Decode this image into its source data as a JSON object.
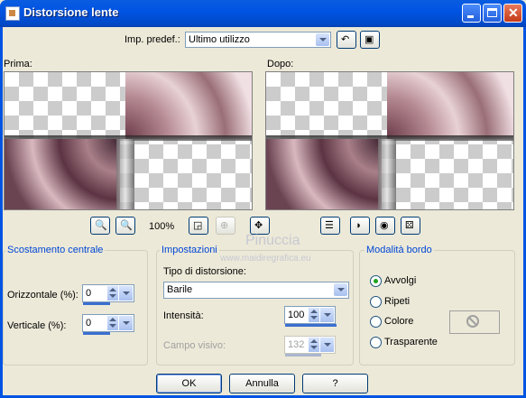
{
  "window": {
    "title": "Distorsione lente"
  },
  "preset": {
    "label": "Imp. predef.:",
    "value": "Ultimo utilizzo"
  },
  "previews": {
    "before_label": "Prima:",
    "after_label": "Dopo:",
    "zoom": "100%"
  },
  "watermark": {
    "name": "Pinuccia",
    "url": "www.maidiregrafica.eu"
  },
  "center_offset": {
    "title": "Scostamento centrale",
    "horizontal_label": "Orizzontale (%):",
    "horizontal_value": "0",
    "vertical_label": "Verticale (%):",
    "vertical_value": "0"
  },
  "settings": {
    "title": "Impostazioni",
    "distortion_type_label": "Tipo di distorsione:",
    "distortion_type_value": "Barile",
    "intensity_label": "Intensità:",
    "intensity_value": "100",
    "fov_label": "Campo visivo:",
    "fov_value": "132"
  },
  "edge_mode": {
    "title": "Modalità bordo",
    "options": [
      "Avvolgi",
      "Ripeti",
      "Colore",
      "Trasparente"
    ],
    "selected": "Avvolgi"
  },
  "buttons": {
    "ok": "OK",
    "cancel": "Annulla",
    "help": "?"
  }
}
